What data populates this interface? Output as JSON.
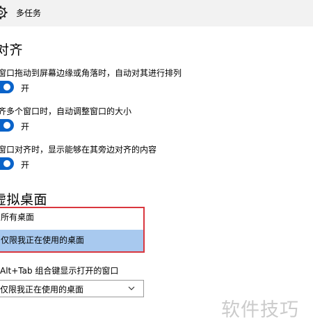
{
  "window": {
    "title": "多任务"
  },
  "snap": {
    "heading": "对齐",
    "options": [
      {
        "description": "窗口拖动到屏幕边缘或角落时，自动对其进行排列",
        "state": "开"
      },
      {
        "description": "齐多个窗口时，自动调整窗口的大小",
        "state": "开"
      },
      {
        "description": "窗口对齐时，显示能够在其旁边对齐的内容",
        "state": "开"
      }
    ]
  },
  "virtual_desktops": {
    "heading": "虚拟桌面",
    "dropdown_options": [
      "所有桌面",
      "仅限我正在使用的桌面"
    ],
    "highlighted_option": "仅限我正在使用的桌面",
    "alt_tab_label": "Alt+Tab 组合键显示打开的窗口",
    "alt_tab_selected": "仅限我正在使用的桌面"
  },
  "watermark": "软件技巧",
  "colors": {
    "toggle_on": "#0a63c9",
    "highlight": "#a8c9ef",
    "annotation_border": "#d9363e"
  }
}
